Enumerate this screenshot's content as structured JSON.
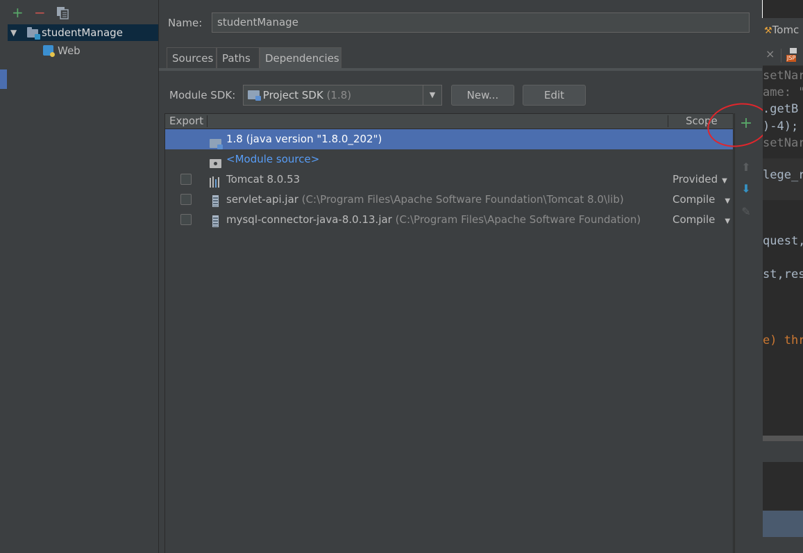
{
  "toolbar": {
    "add_icon": "+",
    "remove_icon": "−",
    "copy_icon": "copy-icon"
  },
  "tree": {
    "items": [
      {
        "label": "studentManage",
        "expanded_glyph": "▼",
        "selected": true
      },
      {
        "label": "Web",
        "selected": false
      }
    ]
  },
  "form": {
    "name_label": "Name:",
    "name_value": "studentManage",
    "tabs": [
      {
        "label": "Sources",
        "active": false
      },
      {
        "label": "Paths",
        "active": false
      },
      {
        "label": "Dependencies",
        "active": true
      }
    ],
    "module_sdk_label": "Module SDK:",
    "sdk_value": "Project SDK",
    "sdk_version": "(1.8)",
    "new_button": "New...",
    "edit_button": "Edit"
  },
  "table": {
    "headers": {
      "export": "Export",
      "scope": "Scope"
    },
    "rows": [
      {
        "name": "1.8 (java version \"1.8.0_202\")",
        "path": "",
        "scope": "",
        "checkbox": false,
        "icon": "sdk-folder-icon",
        "selected": true
      },
      {
        "name": "<Module source>",
        "path": "",
        "scope": "",
        "checkbox": false,
        "icon": "source-folder-icon",
        "selected": false,
        "link": true
      },
      {
        "name": "Tomcat 8.0.53",
        "path": "",
        "scope": "Provided",
        "checkbox": true,
        "icon": "library-icon",
        "selected": false
      },
      {
        "name": "servlet-api.jar",
        "path": "(C:\\Program Files\\Apache Software Foundation\\Tomcat 8.0\\lib)",
        "scope": "Compile",
        "checkbox": true,
        "icon": "jar-icon",
        "selected": false
      },
      {
        "name": "mysql-connector-java-8.0.13.jar",
        "path": "(C:\\Program Files\\Apache Software Foundation)",
        "scope": "Compile",
        "checkbox": true,
        "icon": "jar-icon",
        "selected": false
      }
    ]
  },
  "side_tools": {
    "add": "+",
    "up": "⬆",
    "down": "⬇",
    "edit": "✎"
  },
  "editor": {
    "tab_title": "Tomc",
    "close_glyph": "×",
    "file_badge": "JSP",
    "lines": [
      "setNar",
      "ame: \"",
      ".getB",
      ")-4);",
      "setNar",
      "lege_r",
      "quest,",
      "st,res",
      "e) thr"
    ]
  },
  "colors": {
    "accent": "#4b6eaf",
    "highlight": "#e1262c",
    "link": "#589df6",
    "add": "#59a869"
  }
}
